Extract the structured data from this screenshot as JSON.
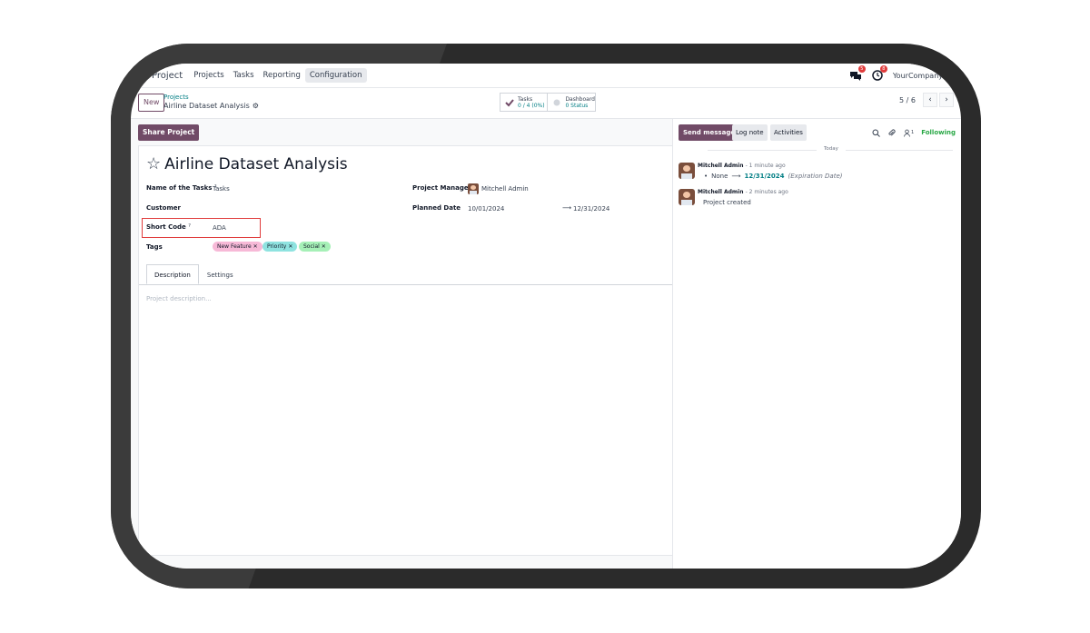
{
  "navbar": {
    "app_name": "Project",
    "menu": [
      "Projects",
      "Tasks",
      "Reporting",
      "Configuration"
    ],
    "messages_badge": "5",
    "activities_badge": "8",
    "company": "YourCompany"
  },
  "control_panel": {
    "new_label": "New",
    "breadcrumb_parent": "Projects",
    "breadcrumb_current": "Airline Dataset Analysis",
    "smart_tasks_label": "Tasks",
    "smart_tasks_value": "0 / 4 (0%)",
    "smart_dashboard_label": "Dashboard",
    "smart_dashboard_value": "0 Status",
    "pager": "5 / 6"
  },
  "form": {
    "share_label": "Share Project",
    "title": "Airline Dataset Analysis",
    "name_of_tasks_label": "Name of the Tasks",
    "name_of_tasks_value": "Tasks",
    "customer_label": "Customer",
    "short_code_label": "Short Code",
    "short_code_value": "ADA",
    "tags_label": "Tags",
    "tags": [
      {
        "label": "New Feature",
        "color": "#f7b9d7"
      },
      {
        "label": "Priority",
        "color": "#8fe3e0"
      },
      {
        "label": "Social",
        "color": "#a6f0b7"
      }
    ],
    "project_manager_label": "Project Manager",
    "project_manager_value": "Mitchell Admin",
    "planned_date_label": "Planned Date",
    "planned_start": "10/01/2024",
    "planned_end": "12/31/2024",
    "help_mark": "?",
    "tabs": [
      "Description",
      "Settings"
    ],
    "description_placeholder": "Project description..."
  },
  "chatter": {
    "send_message": "Send message",
    "log_note": "Log note",
    "activities": "Activities",
    "followers_count": "1",
    "following": "Following",
    "separator": "Today",
    "messages": [
      {
        "author": "Mitchell Admin",
        "time": "- 1 minute ago",
        "tracking_old": "None",
        "tracking_new": "12/31/2024",
        "tracking_field": "(Expiration Date)"
      },
      {
        "author": "Mitchell Admin",
        "time": "- 2 minutes ago",
        "body": "Project created"
      }
    ]
  },
  "colors": {
    "brand": "#714B67",
    "link": "#017e84",
    "highlight_box": "#e03c3c",
    "following": "#28a745"
  }
}
